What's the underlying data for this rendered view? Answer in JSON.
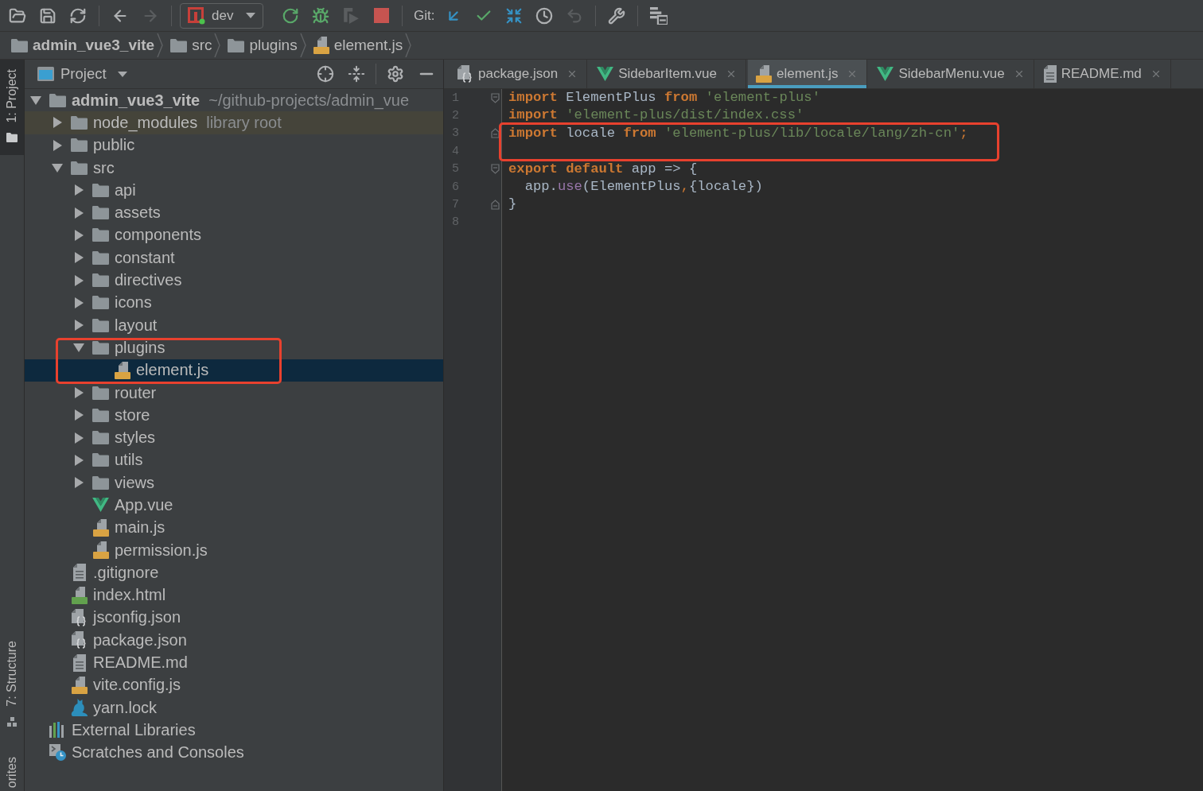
{
  "toolbar": {
    "groups": [
      {
        "buttons": [
          {
            "kind": "open",
            "disabled": false
          },
          {
            "kind": "save",
            "disabled": false
          },
          {
            "kind": "sync",
            "disabled": false
          }
        ]
      },
      {
        "buttons": [
          {
            "kind": "back",
            "disabled": false
          },
          {
            "kind": "forward",
            "disabled": true
          }
        ]
      },
      {
        "run_config": "dev",
        "buttons": [
          {
            "kind": "run",
            "disabled": false
          },
          {
            "kind": "debug",
            "disabled": false
          },
          {
            "kind": "coverage",
            "disabled": true
          },
          {
            "kind": "stop",
            "disabled": false
          }
        ]
      },
      {
        "label": "Git:",
        "buttons": [
          {
            "kind": "update",
            "disabled": false
          },
          {
            "kind": "commit",
            "disabled": false
          },
          {
            "kind": "compare",
            "disabled": false
          },
          {
            "kind": "history",
            "disabled": false
          },
          {
            "kind": "revert",
            "disabled": true
          }
        ]
      },
      {
        "buttons": [
          {
            "kind": "settings",
            "disabled": false
          }
        ]
      },
      {
        "buttons": [
          {
            "kind": "structure",
            "disabled": false
          }
        ]
      }
    ]
  },
  "breadcrumbs": [
    {
      "kind": "project",
      "label": "admin_vue3_vite"
    },
    {
      "kind": "folder",
      "label": "src"
    },
    {
      "kind": "folder",
      "label": "plugins"
    },
    {
      "kind": "js",
      "label": "element.js"
    }
  ],
  "tool_strip": {
    "top": [
      {
        "kind": "project",
        "label": "1: Project",
        "selected": true
      }
    ],
    "bottom": [
      {
        "kind": "structure",
        "label": "7: Structure",
        "selected": false
      },
      {
        "kind": "favorites",
        "label": "orites",
        "selected": false
      }
    ]
  },
  "project_panel": {
    "view": "Project",
    "tree": [
      {
        "kind": "project",
        "name": "admin_vue3_vite",
        "hint": "~/github-projects/admin_vue",
        "expanded": true,
        "selected": false,
        "children": [
          {
            "kind": "library",
            "name": "node_modules",
            "hint": "library root",
            "expanded": false,
            "selected": false
          },
          {
            "kind": "folder",
            "name": "public",
            "expanded": false,
            "selected": false
          },
          {
            "kind": "folder",
            "name": "src",
            "expanded": true,
            "selected": false,
            "children": [
              {
                "kind": "folder",
                "name": "api",
                "expanded": false,
                "selected": false
              },
              {
                "kind": "folder",
                "name": "assets",
                "expanded": false,
                "selected": false
              },
              {
                "kind": "folder",
                "name": "components",
                "expanded": false,
                "selected": false
              },
              {
                "kind": "folder",
                "name": "constant",
                "expanded": false,
                "selected": false
              },
              {
                "kind": "folder",
                "name": "directives",
                "expanded": false,
                "selected": false
              },
              {
                "kind": "folder",
                "name": "icons",
                "expanded": false,
                "selected": false
              },
              {
                "kind": "folder",
                "name": "layout",
                "expanded": false,
                "selected": false
              },
              {
                "kind": "folder",
                "name": "plugins",
                "expanded": true,
                "selected": false,
                "boxed": true,
                "children": [
                  {
                    "kind": "js",
                    "name": "element.js",
                    "selected": true,
                    "boxed": true
                  }
                ]
              },
              {
                "kind": "folder",
                "name": "router",
                "expanded": false,
                "selected": false
              },
              {
                "kind": "folder",
                "name": "store",
                "expanded": false,
                "selected": false
              },
              {
                "kind": "folder",
                "name": "styles",
                "expanded": false,
                "selected": false
              },
              {
                "kind": "folder",
                "name": "utils",
                "expanded": false,
                "selected": false
              },
              {
                "kind": "folder",
                "name": "views",
                "expanded": false,
                "selected": false
              },
              {
                "kind": "vue",
                "name": "App.vue",
                "selected": false
              },
              {
                "kind": "js",
                "name": "main.js",
                "selected": false
              },
              {
                "kind": "js",
                "name": "permission.js",
                "selected": false
              }
            ]
          },
          {
            "kind": "text",
            "name": ".gitignore",
            "selected": false
          },
          {
            "kind": "html",
            "name": "index.html",
            "selected": false
          },
          {
            "kind": "json",
            "name": "jsconfig.json",
            "selected": false
          },
          {
            "kind": "json",
            "name": "package.json",
            "selected": false
          },
          {
            "kind": "text",
            "name": "README.md",
            "selected": false
          },
          {
            "kind": "js",
            "name": "vite.config.js",
            "selected": false
          },
          {
            "kind": "yarn",
            "name": "yarn.lock",
            "selected": false
          }
        ]
      },
      {
        "kind": "libraries",
        "name": "External Libraries",
        "selected": false
      },
      {
        "kind": "scratches",
        "name": "Scratches and Consoles",
        "selected": false
      }
    ]
  },
  "editor": {
    "tabs": [
      {
        "kind": "json",
        "label": "package.json",
        "selected": false
      },
      {
        "kind": "vue",
        "label": "SidebarItem.vue",
        "selected": false
      },
      {
        "kind": "js",
        "label": "element.js",
        "selected": true
      },
      {
        "kind": "vue",
        "label": "SidebarMenu.vue",
        "selected": false
      },
      {
        "kind": "text",
        "label": "README.md",
        "selected": false
      }
    ],
    "lines": [
      {
        "number": "1",
        "fold_start": true,
        "tokens": [
          {
            "kind": "keyword",
            "text": "import"
          },
          {
            "kind": "plain",
            "text": " ElementPlus "
          },
          {
            "kind": "keyword",
            "text": "from"
          },
          {
            "kind": "string",
            "text": " 'element-plus'"
          }
        ]
      },
      {
        "number": "2",
        "tokens": [
          {
            "kind": "keyword",
            "text": "import"
          },
          {
            "kind": "string",
            "text": " 'element-plus/dist/index.css'"
          }
        ]
      },
      {
        "number": "3",
        "fold_end": true,
        "boxed": true,
        "tokens": [
          {
            "kind": "keyword",
            "text": "import"
          },
          {
            "kind": "plain",
            "text": " locale "
          },
          {
            "kind": "keyword",
            "text": "from"
          },
          {
            "kind": "string",
            "text": " 'element-plus/lib/locale/lang/zh-cn'"
          },
          {
            "kind": "punct",
            "text": ";"
          }
        ]
      },
      {
        "number": "4",
        "boxed": true
      },
      {
        "number": "5",
        "fold_start": true,
        "tokens": [
          {
            "kind": "keyword",
            "text": "export"
          },
          {
            "kind": "keyword",
            "text": " default"
          },
          {
            "kind": "plain",
            "text": " app => {"
          }
        ]
      },
      {
        "number": "6",
        "tokens": [
          {
            "kind": "plain",
            "text": "  app."
          },
          {
            "kind": "method",
            "text": "use"
          },
          {
            "kind": "plain",
            "text": "(ElementPlus"
          },
          {
            "kind": "punct",
            "text": ","
          },
          {
            "kind": "plain",
            "text": "{locale})"
          }
        ]
      },
      {
        "number": "7",
        "fold_end": true,
        "tokens": [
          {
            "kind": "plain",
            "text": "}"
          }
        ]
      },
      {
        "number": "8"
      }
    ]
  }
}
